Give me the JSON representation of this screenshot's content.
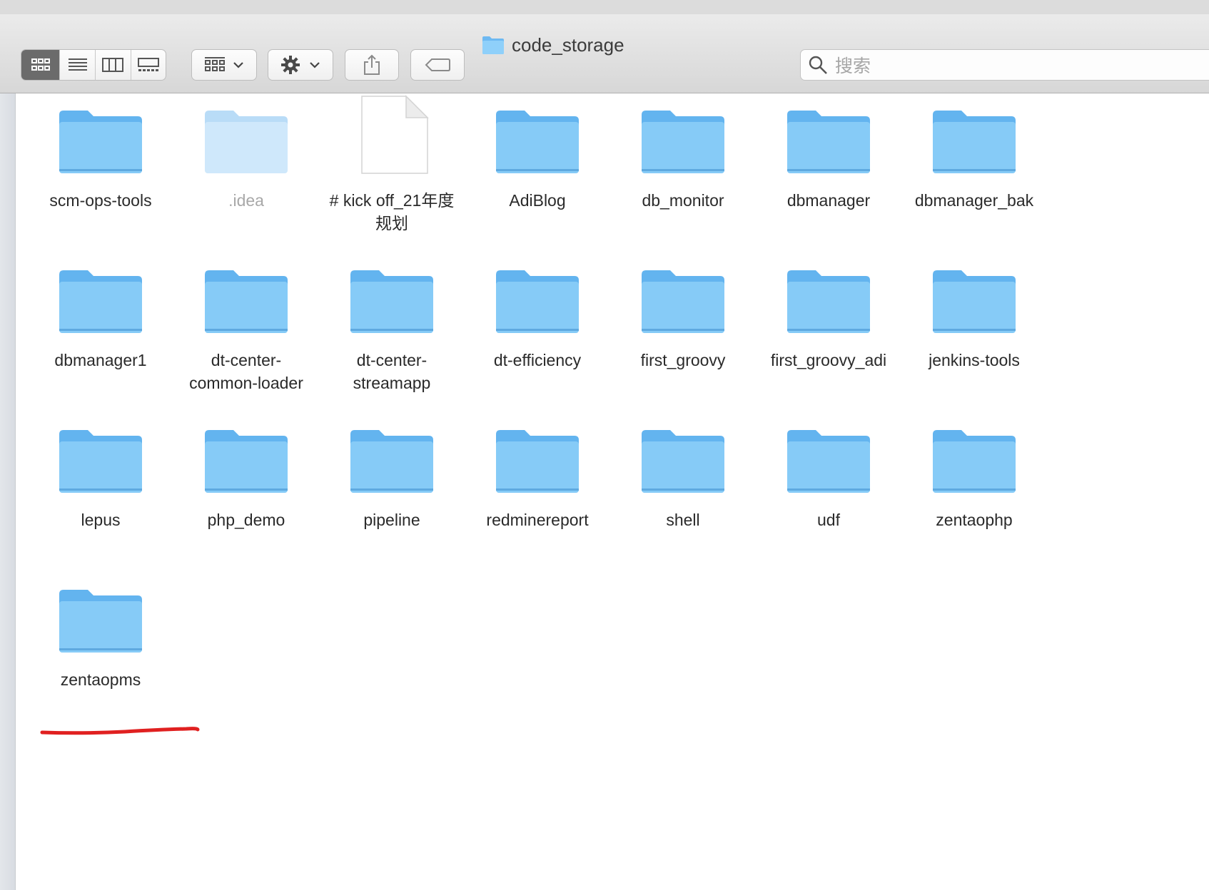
{
  "window": {
    "title": "code_storage"
  },
  "toolbar": {
    "view_modes": [
      {
        "name": "icon-view",
        "icon": "grid-icon",
        "active": true
      },
      {
        "name": "list-view",
        "icon": "list-icon",
        "active": false
      },
      {
        "name": "column-view",
        "icon": "columns-icon",
        "active": false
      },
      {
        "name": "gallery-view",
        "icon": "gallery-icon",
        "active": false
      }
    ],
    "group_icon": "group-grid-icon",
    "action_icon": "gear-icon",
    "share_icon": "share-icon",
    "tag_icon": "tag-icon"
  },
  "search": {
    "placeholder": "搜索"
  },
  "colors": {
    "folder": "#7cc4f6",
    "folder_light": "#bfe2fb",
    "active_segment": "#6b6b6b",
    "annotation": "#e02020"
  },
  "items": [
    {
      "name": "scm-ops-tools",
      "kind": "folder"
    },
    {
      "name": ".idea",
      "kind": "folder-hidden"
    },
    {
      "name": "# kick off_21年度规划",
      "kind": "document"
    },
    {
      "name": "AdiBlog",
      "kind": "folder"
    },
    {
      "name": "db_monitor",
      "kind": "folder"
    },
    {
      "name": "dbmanager",
      "kind": "folder"
    },
    {
      "name": "dbmanager_bak",
      "kind": "folder"
    },
    {
      "name": "dbmanager1",
      "kind": "folder"
    },
    {
      "name": "dt-center-common-loader",
      "kind": "folder"
    },
    {
      "name": "dt-center-streamapp",
      "kind": "folder"
    },
    {
      "name": "dt-efficiency",
      "kind": "folder"
    },
    {
      "name": "first_groovy",
      "kind": "folder"
    },
    {
      "name": "first_groovy_adi",
      "kind": "folder"
    },
    {
      "name": "jenkins-tools",
      "kind": "folder"
    },
    {
      "name": "lepus",
      "kind": "folder"
    },
    {
      "name": "php_demo",
      "kind": "folder"
    },
    {
      "name": "pipeline",
      "kind": "folder"
    },
    {
      "name": "redminereport",
      "kind": "folder"
    },
    {
      "name": "shell",
      "kind": "folder"
    },
    {
      "name": "udf",
      "kind": "folder"
    },
    {
      "name": "zentaophp",
      "kind": "folder"
    },
    {
      "name": "zentaopms",
      "kind": "folder"
    }
  ]
}
